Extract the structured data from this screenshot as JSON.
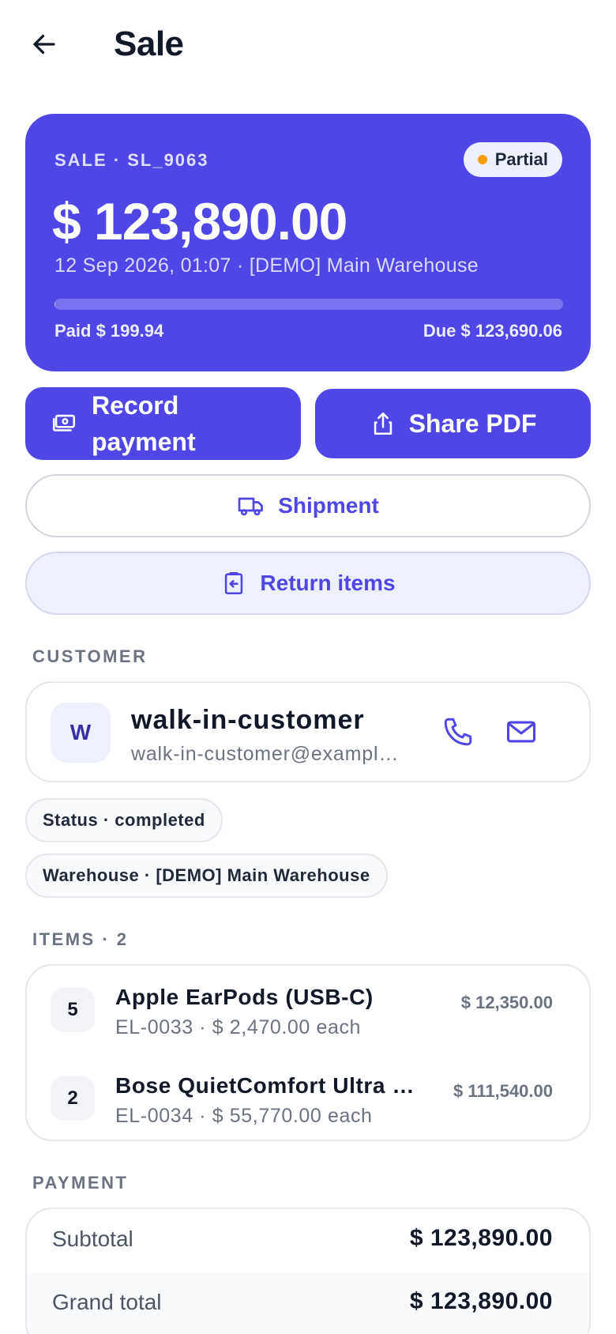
{
  "header": {
    "title": "Sale"
  },
  "sale": {
    "label": "SALE · SL_9063",
    "status": "Partial",
    "amount": "$ 123,890.00",
    "meta": "12 Sep 2026, 01:07 · [DEMO] Main Warehouse",
    "paid": "Paid $ 199.94",
    "due": "Due $ 123,690.06",
    "paid_fraction": 0.0016
  },
  "actions": {
    "record_payment": "Record payment",
    "share_pdf": "Share PDF",
    "shipment": "Shipment",
    "return_items": "Return items"
  },
  "customer": {
    "section_label": "CUSTOMER",
    "initial": "W",
    "name": "walk-in-customer",
    "email": "walk-in-customer@example.com"
  },
  "chips": {
    "status": "Status · completed",
    "warehouse": "Warehouse · [DEMO] Main Warehouse"
  },
  "items": {
    "section_label": "ITEMS · 2",
    "rows": [
      {
        "qty": "5",
        "name": "Apple EarPods (USB-C)",
        "sub": "EL-0033 · $ 2,470.00 each",
        "total": "$ 12,350.00"
      },
      {
        "qty": "2",
        "name": "Bose QuietComfort Ultra Headphones",
        "sub": "EL-0034 · $ 55,770.00 each",
        "total": "$ 111,540.00"
      }
    ]
  },
  "payment": {
    "section_label": "PAYMENT",
    "subtotal_label": "Subtotal",
    "subtotal": "$ 123,890.00",
    "grand_total_label": "Grand total",
    "grand_total": "$ 123,890.00"
  },
  "colors": {
    "primary": "#4f46e5",
    "status_dot": "#f59e0b"
  }
}
